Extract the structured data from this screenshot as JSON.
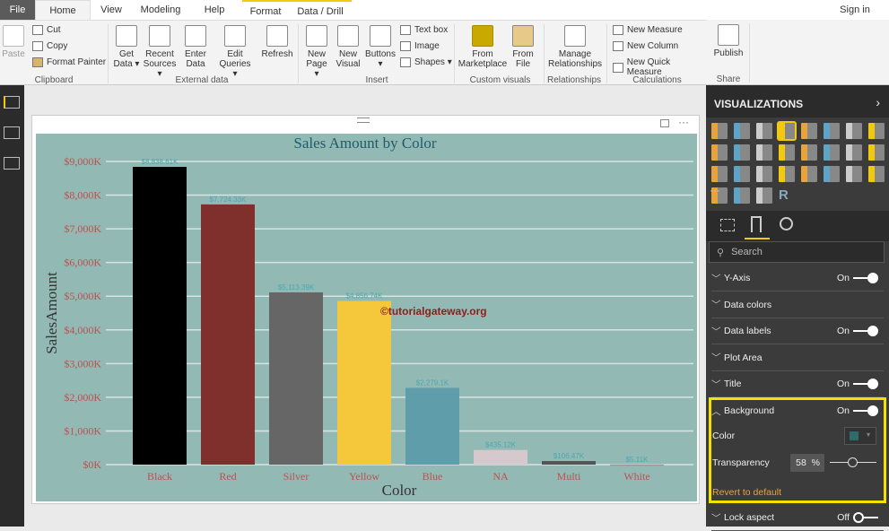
{
  "tabs": {
    "file": "File",
    "home": "Home",
    "view": "View",
    "modeling": "Modeling",
    "help": "Help",
    "format": "Format",
    "data_drill": "Data / Drill",
    "sign_in": "Sign in"
  },
  "ribbon": {
    "paste": "Paste",
    "cut": "Cut",
    "copy": "Copy",
    "format_painter": "Format Painter",
    "clipboard": "Clipboard",
    "get_data": "Get Data ▾",
    "recent_sources": "Recent Sources ▾",
    "enter_data": "Enter Data",
    "edit_queries": "Edit Queries ▾",
    "refresh": "Refresh",
    "external_data": "External data",
    "new_page": "New Page ▾",
    "new_visual": "New Visual",
    "buttons": "Buttons ▾",
    "text_box": "Text box",
    "image": "Image",
    "shapes": "Shapes ▾",
    "insert": "Insert",
    "from_marketplace": "From Marketplace",
    "from_file": "From File",
    "custom_visuals": "Custom visuals",
    "manage_relationships": "Manage Relationships",
    "relationships": "Relationships",
    "new_measure": "New Measure",
    "new_column": "New Column",
    "new_quick_measure": "New Quick Measure",
    "calculations": "Calculations",
    "publish": "Publish",
    "share": "Share"
  },
  "watermark": "©tutorialgateway.org",
  "chart_data": {
    "type": "bar",
    "title": "Sales Amount by Color",
    "xlabel": "Color",
    "ylabel": "SalesAmount",
    "categories": [
      "Black",
      "Red",
      "Silver",
      "Yellow",
      "Blue",
      "NA",
      "Multi",
      "White"
    ],
    "values": [
      8838.61,
      7724.33,
      5113.39,
      4856.74,
      2279.1,
      435.12,
      106.47,
      5.11
    ],
    "data_labels": [
      "$8,838.61K",
      "$7,724.33K",
      "$5,113.39K",
      "$4,856.74K",
      "$2,279.1K",
      "$435.12K",
      "$106.47K",
      "$5.11K"
    ],
    "colors": [
      "#000000",
      "#7f2f2c",
      "#666666",
      "#f4c83a",
      "#5f9dab",
      "#d6c9cd",
      "#555555",
      "#9a9a9a"
    ],
    "yticks": [
      "$0K",
      "$1,000K",
      "$2,000K",
      "$3,000K",
      "$4,000K",
      "$5,000K",
      "$6,000K",
      "$7,000K",
      "$8,000K",
      "$9,000K"
    ],
    "ylim": [
      0,
      9000
    ],
    "background": "#93b9b5",
    "grid": true
  },
  "pane": {
    "title": "VISUALIZATIONS",
    "more": "···",
    "search_placeholder": "Search",
    "rows": [
      {
        "label": "Y-Axis",
        "state": "On"
      },
      {
        "label": "Data colors"
      },
      {
        "label": "Data labels",
        "state": "On"
      },
      {
        "label": "Plot Area"
      },
      {
        "label": "Title",
        "state": "On"
      },
      {
        "label": "Background",
        "state": "On"
      }
    ],
    "color_label": "Color",
    "transparency_label": "Transparency",
    "transparency_value": "58",
    "transparency_unit": "%",
    "transparency": 58,
    "revert": "Revert to default",
    "lock_aspect": "Lock aspect",
    "lock_state": "Off"
  }
}
